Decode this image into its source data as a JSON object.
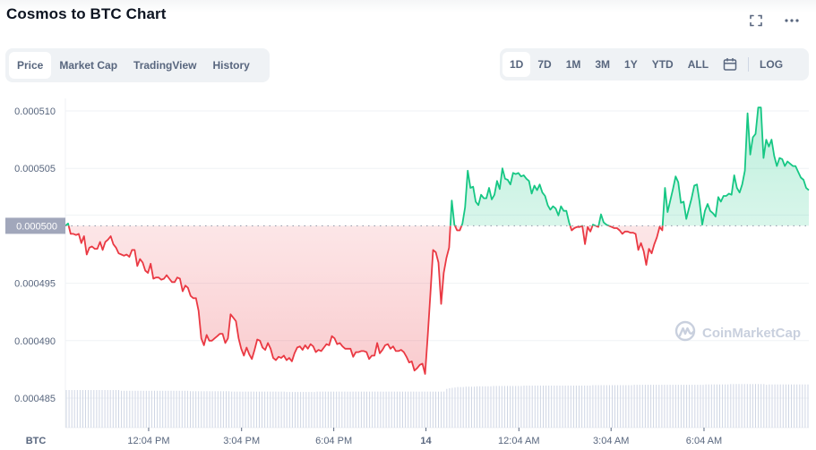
{
  "header": {
    "title": "Cosmos to BTC Chart",
    "fullscreen_icon": "fullscreen-icon",
    "more_icon": "more-horizontal-icon"
  },
  "tabs": [
    {
      "label": "Price",
      "active": true
    },
    {
      "label": "Market Cap",
      "active": false
    },
    {
      "label": "TradingView",
      "active": false
    },
    {
      "label": "History",
      "active": false
    }
  ],
  "ranges": [
    {
      "label": "1D",
      "active": true
    },
    {
      "label": "7D",
      "active": false
    },
    {
      "label": "1M",
      "active": false
    },
    {
      "label": "3M",
      "active": false
    },
    {
      "label": "1Y",
      "active": false
    },
    {
      "label": "YTD",
      "active": false
    },
    {
      "label": "ALL",
      "active": false
    }
  ],
  "calendar_icon": "calendar-icon",
  "log_label": "LOG",
  "watermark": "CoinMarketCap",
  "colors": {
    "up": "#16c784",
    "down": "#ea3943",
    "grid": "#eff2f5",
    "axis_text": "#58667e",
    "volume": "#cfd6e4",
    "ref_label_bg": "#a1a7bb"
  },
  "chart_data": {
    "type": "line",
    "title": "Cosmos to BTC Chart",
    "xlabel": "",
    "ylabel": "BTC",
    "y_axis_unit_label": "BTC",
    "ylim": [
      0.0004835,
      0.0005115
    ],
    "yticks": [
      "0.000510",
      "0.000505",
      "0.000500",
      "0.000495",
      "0.000490",
      "0.000485"
    ],
    "ytick_values": [
      0.00051,
      0.000505,
      0.0005,
      0.000495,
      0.00049,
      0.000485
    ],
    "reference_value": 0.0005,
    "reference_label": "0.000500",
    "xticks": [
      {
        "label": "12:04 PM",
        "t": 0.112,
        "bold": false
      },
      {
        "label": "3:04 PM",
        "t": 0.237,
        "bold": false
      },
      {
        "label": "6:04 PM",
        "t": 0.361,
        "bold": false
      },
      {
        "label": "14",
        "t": 0.485,
        "bold": true
      },
      {
        "label": "12:04 AM",
        "t": 0.61,
        "bold": false
      },
      {
        "label": "3:04 AM",
        "t": 0.734,
        "bold": false
      },
      {
        "label": "6:04 AM",
        "t": 0.859,
        "bold": false
      }
    ],
    "grid": true,
    "legend": "none",
    "series": [
      {
        "name": "ATOM/BTC price",
        "values": [
          0.0005,
          0.0005002,
          0.0004993,
          0.0004993,
          0.0004992,
          0.0004993,
          0.0004985,
          0.0004991,
          0.0004975,
          0.0004981,
          0.0004982,
          0.000498,
          0.000498,
          0.0004986,
          0.0004979,
          0.0004986,
          0.0004988,
          0.0004991,
          0.0004984,
          0.0004981,
          0.0004976,
          0.0004975,
          0.0004974,
          0.0004975,
          0.0004973,
          0.0004979,
          0.0004979,
          0.0004965,
          0.0004971,
          0.0004968,
          0.0004961,
          0.0004959,
          0.0004967,
          0.0004954,
          0.0004955,
          0.0004955,
          0.0004953,
          0.0004954,
          0.0004957,
          0.0004954,
          0.0004951,
          0.0004951,
          0.0004955,
          0.0004954,
          0.0004943,
          0.0004948,
          0.0004946,
          0.0004939,
          0.0004937,
          0.0004937,
          0.0004926,
          0.0004902,
          0.0004896,
          0.0004905,
          0.00049,
          0.00049,
          0.0004902,
          0.0004904,
          0.0004906,
          0.0004906,
          0.0004898,
          0.0004902,
          0.0004923,
          0.000492,
          0.0004917,
          0.0004902,
          0.0004893,
          0.0004887,
          0.0004894,
          0.0004888,
          0.0004884,
          0.0004892,
          0.0004901,
          0.00049,
          0.0004894,
          0.0004892,
          0.0004898,
          0.0004893,
          0.0004885,
          0.0004883,
          0.0004886,
          0.0004885,
          0.0004887,
          0.0004883,
          0.0004885,
          0.0004882,
          0.0004889,
          0.0004894,
          0.0004895,
          0.0004892,
          0.0004896,
          0.0004893,
          0.0004897,
          0.0004895,
          0.000489,
          0.0004892,
          0.0004891,
          0.0004894,
          0.0004897,
          0.0004896,
          0.0004904,
          0.0004902,
          0.0004897,
          0.0004898,
          0.0004895,
          0.0004893,
          0.0004893,
          0.0004893,
          0.0004886,
          0.000489,
          0.000489,
          0.0004891,
          0.0004891,
          0.000489,
          0.0004884,
          0.0004887,
          0.0004887,
          0.0004898,
          0.0004889,
          0.0004892,
          0.0004896,
          0.0004897,
          0.0004893,
          0.0004895,
          0.0004891,
          0.0004891,
          0.0004892,
          0.000489,
          0.0004886,
          0.0004881,
          0.0004882,
          0.0004874,
          0.0004876,
          0.0004879,
          0.000488,
          0.0004871,
          0.0004905,
          0.0004942,
          0.0004979,
          0.0004977,
          0.0004968,
          0.0004932,
          0.0004959,
          0.0004972,
          0.0004981,
          0.0005022,
          0.0005001,
          0.0004996,
          0.0004996,
          0.0005002,
          0.0005016,
          0.0005048,
          0.0005033,
          0.0005034,
          0.0005021,
          0.0005018,
          0.0005027,
          0.0005024,
          0.0005024,
          0.0005033,
          0.0005023,
          0.0005027,
          0.0005039,
          0.0005032,
          0.000505,
          0.0005041,
          0.000504,
          0.0005036,
          0.0005046,
          0.0005045,
          0.0005046,
          0.0005043,
          0.0005044,
          0.0005041,
          0.0005039,
          0.0005028,
          0.0005035,
          0.0005031,
          0.0005036,
          0.0005029,
          0.0005026,
          0.0005018,
          0.0005014,
          0.0005017,
          0.0005015,
          0.0005009,
          0.0005017,
          0.0005013,
          0.0005013,
          0.0005003,
          0.0004996,
          0.0004998,
          0.0004999,
          0.0004999,
          0.0005,
          0.0004984,
          0.0004999,
          0.0004995,
          0.0005001,
          0.0005,
          0.0004999,
          0.000501,
          0.0005003,
          0.0005001,
          0.0005,
          0.0004999,
          0.0004998,
          0.0004998,
          0.0004996,
          0.0004993,
          0.0004995,
          0.0004995,
          0.0004994,
          0.0004994,
          0.0004993,
          0.0004979,
          0.0004985,
          0.0004978,
          0.0004966,
          0.000498,
          0.0004976,
          0.0004984,
          0.000499,
          0.0004999,
          0.0004996,
          0.0005033,
          0.0005012,
          0.0005022,
          0.0005032,
          0.0005043,
          0.0005038,
          0.000502,
          0.0005021,
          0.0005006,
          0.0005015,
          0.0005024,
          0.0005035,
          0.0005036,
          0.0005021,
          0.0005001,
          0.0005013,
          0.0005019,
          0.0005013,
          0.0005011,
          0.0005008,
          0.0005025,
          0.0005021,
          0.0005026,
          0.0005026,
          0.0005028,
          0.0005027,
          0.0005044,
          0.0005033,
          0.0005029,
          0.0005036,
          0.0005048,
          0.0005098,
          0.0005062,
          0.0005077,
          0.000508,
          0.0005103,
          0.0005103,
          0.0005059,
          0.0005075,
          0.0005069,
          0.0005075,
          0.0005061,
          0.0005052,
          0.0005059,
          0.0005058,
          0.0005052,
          0.0005056,
          0.0005054,
          0.0005052,
          0.0005052,
          0.0005047,
          0.0005042,
          0.000504,
          0.0005033,
          0.0005031
        ]
      },
      {
        "name": "Volume",
        "note": "relative volume bars along the bottom",
        "values": [
          1.0,
          1.0,
          1.0,
          1.0,
          1.0,
          1.0,
          1.0,
          1.0,
          1.0,
          1.0,
          1.0,
          1.0,
          1.0,
          1.0,
          1.0,
          1.0,
          1.0,
          1.0,
          1.0,
          1.0,
          0.98,
          0.98,
          0.98,
          0.98,
          0.98,
          0.98,
          0.98,
          0.98,
          0.98,
          0.98,
          0.98,
          0.98,
          0.98,
          0.98,
          0.98,
          0.98,
          0.98,
          0.98,
          0.98,
          0.98,
          0.98,
          0.98,
          0.98,
          0.98,
          0.98,
          0.97,
          0.97,
          0.97,
          0.97,
          0.97,
          0.97,
          0.97,
          0.97,
          0.97,
          0.97,
          0.97,
          0.97,
          0.97,
          0.97,
          0.97,
          0.96,
          0.96,
          0.96,
          0.96,
          0.96,
          0.96,
          0.96,
          0.96,
          0.96,
          0.96,
          0.96,
          0.96,
          0.96,
          0.96,
          0.96,
          0.96,
          0.96,
          0.96,
          0.96,
          0.96,
          0.95,
          0.95,
          0.95,
          0.95,
          0.95,
          0.95,
          0.95,
          0.95,
          0.95,
          0.95,
          0.95,
          0.96,
          0.96,
          0.96,
          0.96,
          0.96,
          0.96,
          0.96,
          0.96,
          0.96,
          0.96,
          0.96,
          0.96,
          0.96,
          0.96,
          0.96,
          0.96,
          0.96,
          0.96,
          0.96,
          0.96,
          0.96,
          0.96,
          0.96,
          0.96,
          0.96,
          0.96,
          0.96,
          0.96,
          0.96,
          0.96,
          0.96,
          0.96,
          0.96,
          0.96,
          0.96,
          0.96,
          0.96,
          0.96,
          0.96,
          0.96,
          0.96,
          0.96,
          0.96,
          0.96,
          0.96,
          0.96,
          0.96,
          1.03,
          1.05,
          1.06,
          1.07,
          1.08,
          1.08,
          1.08,
          1.09,
          1.09,
          1.09,
          1.09,
          1.1,
          1.1,
          1.1,
          1.1,
          1.1,
          1.1,
          1.11,
          1.11,
          1.11,
          1.11,
          1.11,
          1.11,
          1.11,
          1.11,
          1.11,
          1.11,
          1.11,
          1.12,
          1.12,
          1.12,
          1.12,
          1.12,
          1.12,
          1.12,
          1.12,
          1.12,
          1.12,
          1.12,
          1.12,
          1.12,
          1.12,
          1.12,
          1.12,
          1.12,
          1.12,
          1.12,
          1.12,
          1.12,
          1.12,
          1.12,
          1.12,
          1.12,
          1.13,
          1.13,
          1.13,
          1.13,
          1.13,
          1.13,
          1.13,
          1.13,
          1.13,
          1.13,
          1.13,
          1.13,
          1.13,
          1.13,
          1.13,
          1.14,
          1.14,
          1.14,
          1.14,
          1.14,
          1.14,
          1.14,
          1.14,
          1.14,
          1.14,
          1.14,
          1.14,
          1.14,
          1.14,
          1.14,
          1.14,
          1.14,
          1.14,
          1.14,
          1.14,
          1.14,
          1.14,
          1.14,
          1.14,
          1.14,
          1.14,
          1.15,
          1.15,
          1.15,
          1.15,
          1.15,
          1.15,
          1.15,
          1.15,
          1.15,
          1.16,
          1.16,
          1.16,
          1.16,
          1.16,
          1.16,
          1.16,
          1.16,
          1.16,
          1.16,
          1.16,
          1.16,
          1.16,
          1.14,
          1.15,
          1.15,
          1.15,
          1.15,
          1.15,
          1.15,
          1.15,
          1.15,
          1.15,
          1.15,
          1.15,
          1.15,
          1.15,
          1.15,
          1.15
        ]
      }
    ]
  }
}
